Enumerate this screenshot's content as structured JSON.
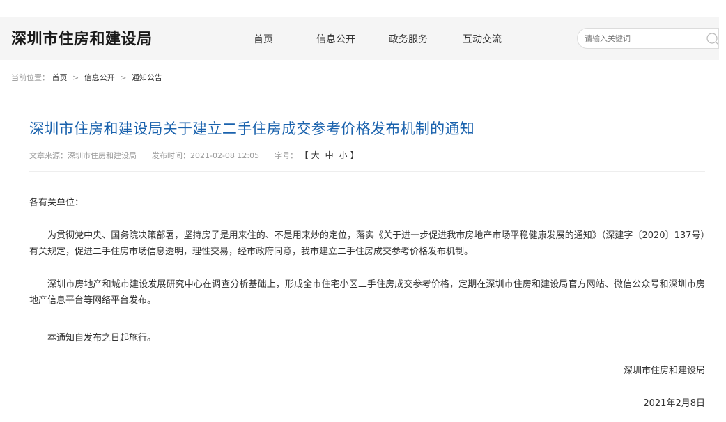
{
  "header": {
    "logo": "深圳市住房和建设局",
    "nav": [
      "首页",
      "信息公开",
      "政务服务",
      "互动交流"
    ],
    "search_placeholder": "请输入关键词"
  },
  "breadcrumb": {
    "prefix": "当前位置：",
    "items": [
      "首页",
      "信息公开",
      "通知公告"
    ],
    "separator": ">"
  },
  "article": {
    "title": "深圳市住房和建设局关于建立二手住房成交参考价格发布机制的通知",
    "source_label": "文章来源：深圳市住房和建设局",
    "publish_label": "发布时间：2021-02-08 12:05",
    "font_size_label": "字号：",
    "font_size_open": "【",
    "font_size_options": [
      "大",
      "中",
      "小"
    ],
    "font_size_close": "】",
    "salutation": "各有关单位：",
    "paragraphs": [
      "为贯彻党中央、国务院决策部署，坚持房子是用来住的、不是用来炒的定位，落实《关于进一步促进我市房地产市场平稳健康发展的通知》（深建字〔2020〕137号）有关规定，促进二手住房市场信息透明，理性交易，经市政府同意，我市建立二手住房成交参考价格发布机制。",
      "深圳市房地产和城市建设发展研究中心在调查分析基础上，形成全市住宅小区二手住房成交参考价格，定期在深圳市住房和建设局官方网站、微信公众号和深圳市房地产信息平台等网络平台发布。",
      "本通知自发布之日起施行。"
    ],
    "signature": "深圳市住房和建设局",
    "date": "2021年2月8日"
  },
  "colors": {
    "title": "#1a62ad",
    "header_bg": "#f5f5f5",
    "meta": "#999999"
  },
  "icons": {
    "search": "search-icon"
  }
}
